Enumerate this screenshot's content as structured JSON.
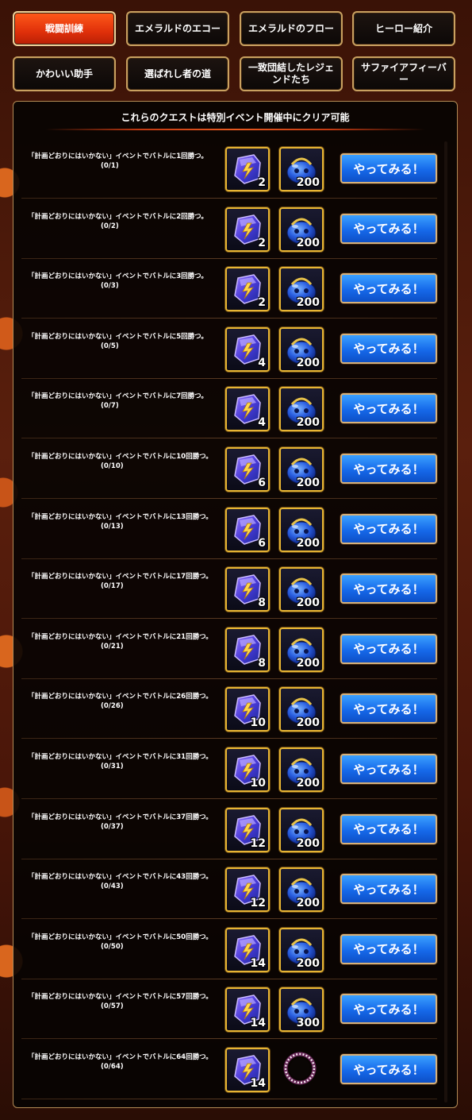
{
  "tabs": [
    {
      "label": "戦闘訓練",
      "active": true
    },
    {
      "label": "エメラルドのエコー",
      "active": false
    },
    {
      "label": "エメラルドのフロー",
      "active": false
    },
    {
      "label": "ヒーロー紹介",
      "active": false
    },
    {
      "label": "かわいい助手",
      "active": false
    },
    {
      "label": "選ばれし者の道",
      "active": false
    },
    {
      "label": "一致団結したレジェンドたち",
      "active": false
    },
    {
      "label": "サファイアフィーバー",
      "active": false
    }
  ],
  "notice": "これらのクエストは特別イベント開催中にクリア可能",
  "button_label": "やってみる！",
  "colors": {
    "active_tab": "#e0300a",
    "tab_border": "#c9a160",
    "go_button": "#1669ea",
    "reward_border": "#e7b534"
  },
  "quests": [
    {
      "text": "「計画どおりにはいかない」イベントでバトルに1回勝つ。",
      "progress": "(0/1)",
      "reward1_icon": "gem-shard-icon",
      "reward1_qty": "2",
      "reward2_icon": "blue-slime-icon",
      "reward2_qty": "200"
    },
    {
      "text": "「計画どおりにはいかない」イベントでバトルに2回勝つ。",
      "progress": "(0/2)",
      "reward1_icon": "gem-shard-icon",
      "reward1_qty": "2",
      "reward2_icon": "blue-slime-icon",
      "reward2_qty": "200"
    },
    {
      "text": "「計画どおりにはいかない」イベントでバトルに3回勝つ。",
      "progress": "(0/3)",
      "reward1_icon": "gem-shard-icon",
      "reward1_qty": "2",
      "reward2_icon": "blue-slime-icon",
      "reward2_qty": "200"
    },
    {
      "text": "「計画どおりにはいかない」イベントでバトルに5回勝つ。",
      "progress": "(0/5)",
      "reward1_icon": "gem-shard-icon",
      "reward1_qty": "4",
      "reward2_icon": "blue-slime-icon",
      "reward2_qty": "200"
    },
    {
      "text": "「計画どおりにはいかない」イベントでバトルに7回勝つ。",
      "progress": "(0/7)",
      "reward1_icon": "gem-shard-icon",
      "reward1_qty": "4",
      "reward2_icon": "blue-slime-icon",
      "reward2_qty": "200"
    },
    {
      "text": "「計画どおりにはいかない」イベントでバトルに10回勝つ。",
      "progress": "(0/10)",
      "reward1_icon": "gem-shard-icon",
      "reward1_qty": "6",
      "reward2_icon": "blue-slime-icon",
      "reward2_qty": "200"
    },
    {
      "text": "「計画どおりにはいかない」イベントでバトルに13回勝つ。",
      "progress": "(0/13)",
      "reward1_icon": "gem-shard-icon",
      "reward1_qty": "6",
      "reward2_icon": "blue-slime-icon",
      "reward2_qty": "200"
    },
    {
      "text": "「計画どおりにはいかない」イベントでバトルに17回勝つ。",
      "progress": "(0/17)",
      "reward1_icon": "gem-shard-icon",
      "reward1_qty": "8",
      "reward2_icon": "blue-slime-icon",
      "reward2_qty": "200"
    },
    {
      "text": "「計画どおりにはいかない」イベントでバトルに21回勝つ。",
      "progress": "(0/21)",
      "reward1_icon": "gem-shard-icon",
      "reward1_qty": "8",
      "reward2_icon": "blue-slime-icon",
      "reward2_qty": "200"
    },
    {
      "text": "「計画どおりにはいかない」イベントでバトルに26回勝つ。",
      "progress": "(0/26)",
      "reward1_icon": "gem-shard-icon",
      "reward1_qty": "10",
      "reward2_icon": "blue-slime-icon",
      "reward2_qty": "200"
    },
    {
      "text": "「計画どおりにはいかない」イベントでバトルに31回勝つ。",
      "progress": "(0/31)",
      "reward1_icon": "gem-shard-icon",
      "reward1_qty": "10",
      "reward2_icon": "blue-slime-icon",
      "reward2_qty": "200"
    },
    {
      "text": "「計画どおりにはいかない」イベントでバトルに37回勝つ。",
      "progress": "(0/37)",
      "reward1_icon": "gem-shard-icon",
      "reward1_qty": "12",
      "reward2_icon": "blue-slime-icon",
      "reward2_qty": "200"
    },
    {
      "text": "「計画どおりにはいかない」イベントでバトルに43回勝つ。",
      "progress": "(0/43)",
      "reward1_icon": "gem-shard-icon",
      "reward1_qty": "12",
      "reward2_icon": "blue-slime-icon",
      "reward2_qty": "200"
    },
    {
      "text": "「計画どおりにはいかない」イベントでバトルに50回勝つ。",
      "progress": "(0/50)",
      "reward1_icon": "gem-shard-icon",
      "reward1_qty": "14",
      "reward2_icon": "blue-slime-icon",
      "reward2_qty": "200"
    },
    {
      "text": "「計画どおりにはいかない」イベントでバトルに57回勝つ。",
      "progress": "(0/57)",
      "reward1_icon": "gem-shard-icon",
      "reward1_qty": "14",
      "reward2_icon": "blue-slime-icon",
      "reward2_qty": "300"
    },
    {
      "text": "「計画どおりにはいかない」イベントでバトルに64回勝つ。",
      "progress": "(0/64)",
      "reward1_icon": "gem-shard-icon",
      "reward1_qty": "14",
      "reward2_icon": "pearl-ring-icon",
      "reward2_qty": ""
    }
  ]
}
